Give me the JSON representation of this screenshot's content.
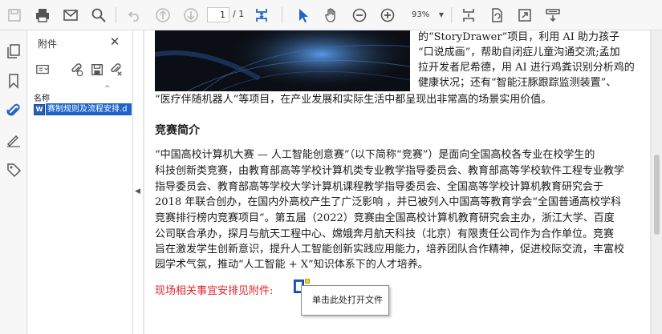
{
  "toolbar": {
    "page_current": "1",
    "page_total": "/ 1",
    "zoom": "93%",
    "icons": [
      "save-icon",
      "print-icon",
      "email-icon",
      "search-icon",
      "undo-icon",
      "page-up-icon",
      "page-down-icon",
      "fit-page-icon",
      "select-tool-icon",
      "hand-tool-icon",
      "zoom-out-icon",
      "zoom-in-icon",
      "fit-width-icon",
      "rotate-icon",
      "fullscreen-icon",
      "more-tools-icon"
    ]
  },
  "strip": {
    "icons": [
      "pages-icon",
      "bookmark-icon",
      "attachment-icon",
      "signature-icon",
      "tag-icon"
    ],
    "accent": "#1e63c9"
  },
  "panel": {
    "title": "附件",
    "column_header": "名称",
    "files": [
      {
        "name": "赛制规则及流程安排.d"
      }
    ]
  },
  "document": {
    "top_lines": [
      "的“StoryDrawer”项目，利用 AI 助力孩子",
      "“口说成画”，帮助自闭症儿童沟通交流;孟加",
      "拉开发者尼希德，用 AI 进行鸡粪识别分析鸡的",
      "健康状况；还有“智能汪豚跟踪监测装置”、"
    ],
    "full_line": "“医疗伴随机器人”等项目，在产业发展和实际生活中都呈现出非常高的场景实用价值。",
    "heading": "竞赛简介",
    "paragraph": [
      "“中国高校计算机大赛 — 人工智能创意赛”（以下简称“竞赛”）是面向全国高校各专业在校学生的",
      "科技创新类竞赛，由教育部高等学校计算机类专业教学指导委员会、教育部高等学校软件工程专业教学",
      "指导委员会、教育部高等学校大学计算机课程教学指导委员会、全国高等学校计算机教育研究会于",
      "2018 年联合创办，在国内外高校产生了广泛影响 ，并已被列入中国高等教育学会“全国普通高校学科",
      "竞赛排行榜内竞赛项目”。第五届（2022）竞赛由全国高校计算机教育研究会主办，浙江大学、百度",
      "公司联合承办，探月与航天工程中心、嫦娥奔月航天科技（北京）有限责任公司作为合作单位。竞赛",
      "旨在激发学生创新意识，提升人工智能创新实践应用能力，培养团队合作精神，促进校际交流，丰富校",
      "园学术气氛，推动“人工智能 + X”知识体系下的人才培养。"
    ],
    "attachment_line": "现场相关事宜安排见附件:",
    "tooltip": "单击此处打开文件",
    "link_color": "#e8212b"
  }
}
